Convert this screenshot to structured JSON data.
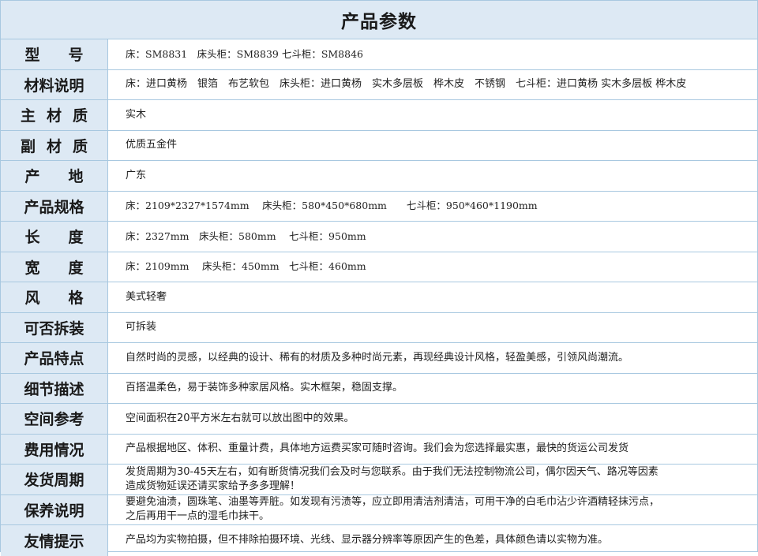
{
  "page": {
    "title": "产品参数"
  },
  "params": [
    {
      "label": "型　号",
      "value": "床：SM8831　床头柜：SM8839 七斗柜：SM8846"
    },
    {
      "label": "材料说明",
      "value": "床：进口黄杨　银箔　布艺软包　床头柜：进口黄杨　实木多层板　桦木皮　不锈钢　七斗柜：进口黄杨 实木多层板 桦木皮"
    },
    {
      "label": "主材质",
      "value": "实木"
    },
    {
      "label": "副材质",
      "value": "优质五金件"
    },
    {
      "label": "产　地",
      "value": "广东"
    },
    {
      "label": "产品规格",
      "value": "床：2109*2327*1574mm　 床头柜：580*450*680mm　　七斗柜：950*460*1190mm"
    },
    {
      "label": "长　度",
      "value": "床：2327mm　床头柜：580mm　 七斗柜：950mm"
    },
    {
      "label": "宽　度",
      "value": "床：2109mm　 床头柜：450mm　七斗柜：460mm"
    },
    {
      "label": "风　格",
      "value": "美式轻奢"
    },
    {
      "label": "可否拆装",
      "value": "可拆装"
    },
    {
      "label": "产品特点",
      "value": "自然时尚的灵感，以经典的设计、稀有的材质及多种时尚元素，再现经典设计风格，轻盈美感，引领风尚潮流。"
    },
    {
      "label": "细节描述",
      "value": "百搭温柔色，易于装饰多种家居风格。实木框架，稳固支撑。"
    },
    {
      "label": "空间参考",
      "value": "空间面积在20平方米左右就可以放出图中的效果。"
    },
    {
      "label": "费用情况",
      "value": "产品根据地区、体积、重量计费，具体地方运费买家可随时咨询。我们会为您选择最实惠，最快的货运公司发货"
    },
    {
      "label": "发货周期",
      "value": "发货周期为30-45天左右，如有断货情况我们会及时与您联系。由于我们无法控制物流公司，偶尔因天气、路况等因素\n造成货物延误还请买家给予多多理解！"
    },
    {
      "label": "保养说明",
      "value": "要避免油渍，圆珠笔、油墨等弄脏。如发现有污渍等，应立即用清洁剂清洁，可用干净的白毛巾沾少许酒精轻抹污点，\n之后再用干一点的湿毛巾抹干。"
    },
    {
      "label": "友情提示",
      "value": "产品均为实物拍摄，但不排除拍摄环境、光线、显示器分辨率等原因产生的色差，具体颜色请以实物为准。"
    }
  ],
  "colors": {
    "header_bg": "#dde9f4",
    "border": "#a8c8e0",
    "label_bg": "#dde9f4"
  }
}
